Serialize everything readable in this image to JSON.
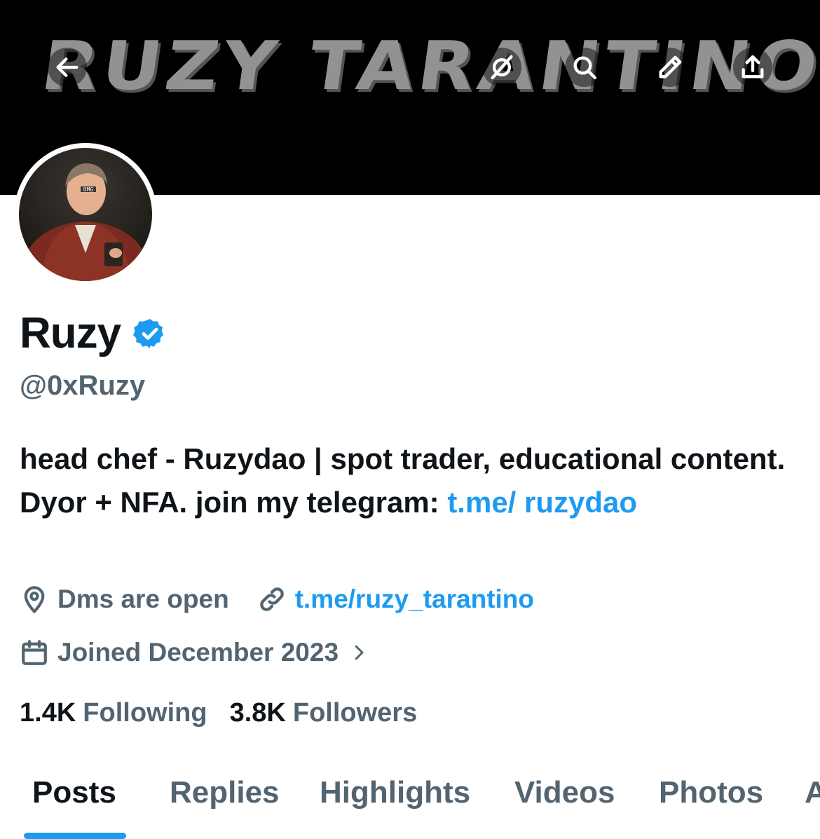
{
  "banner": {
    "art_text": "RUZY TARANTINO"
  },
  "header_icons": {
    "back": "back-arrow-icon",
    "hide": "eye-off-icon",
    "search": "search-icon",
    "edit": "pencil-icon",
    "share": "share-icon",
    "icon_color": "#ffffff"
  },
  "profile": {
    "avatar_text": "OMG",
    "name": "Ruzy",
    "handle": "@0xRuzy",
    "verified_color": "#1d9bf0"
  },
  "bio": {
    "text": "head chef - Ruzydao | spot trader, educational content. Dyor + NFA. join my telegram: ",
    "link": "t.me/ ruzydao"
  },
  "meta": {
    "location": "Dms are open",
    "website": "t.me/ruzy_tarantino",
    "joined": "Joined December 2023"
  },
  "stats": {
    "following_count": "1.4K",
    "following_label": "Following",
    "followers_count": "3.8K",
    "followers_label": "Followers"
  },
  "tabs": [
    {
      "label": "Posts"
    },
    {
      "label": "Replies"
    },
    {
      "label": "Highlights"
    },
    {
      "label": "Videos"
    },
    {
      "label": "Photos"
    },
    {
      "label": "A"
    }
  ],
  "colors": {
    "accent": "#1d9bf0",
    "secondary_text": "#536471",
    "primary_text": "#0f1419"
  }
}
